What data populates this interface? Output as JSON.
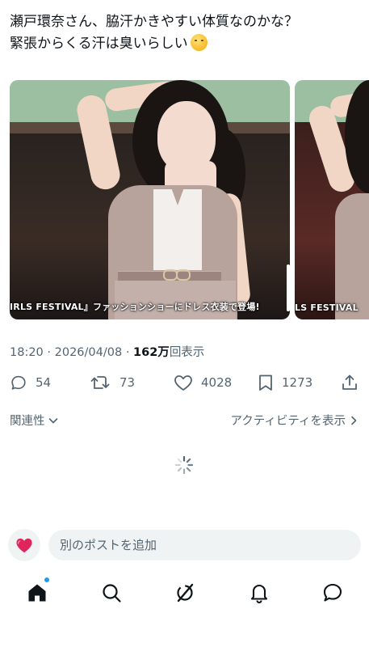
{
  "tweet": {
    "line1": "瀬戸環奈さん、脇汗かきやすい体質なのかな？",
    "line2": "緊張からくる汗は臭いらしい",
    "emoji": "shushing-face-emoji"
  },
  "media": {
    "caption_1": "IRLS FESTIVAL』ファッションショーにドレス衣装で登場!",
    "caption_2": "LS FESTIVAL"
  },
  "meta": {
    "time": "18:20",
    "separator": "·",
    "date": "2026/04/08",
    "views_count": "162万",
    "views_label": "回表示"
  },
  "actions": {
    "replies": "54",
    "reposts": "73",
    "likes": "4028",
    "bookmarks": "1273"
  },
  "links": {
    "related": "関連性",
    "activity": "アクティビティを表示"
  },
  "composer": {
    "placeholder": "別のポストを追加"
  },
  "nav": {
    "items": [
      "home-icon",
      "search-icon",
      "grok-icon",
      "notifications-icon",
      "messages-icon"
    ]
  },
  "colors": {
    "accent": "#1d9bf0",
    "muted": "#536471",
    "text": "#0f1419",
    "heart": "#f91880"
  }
}
